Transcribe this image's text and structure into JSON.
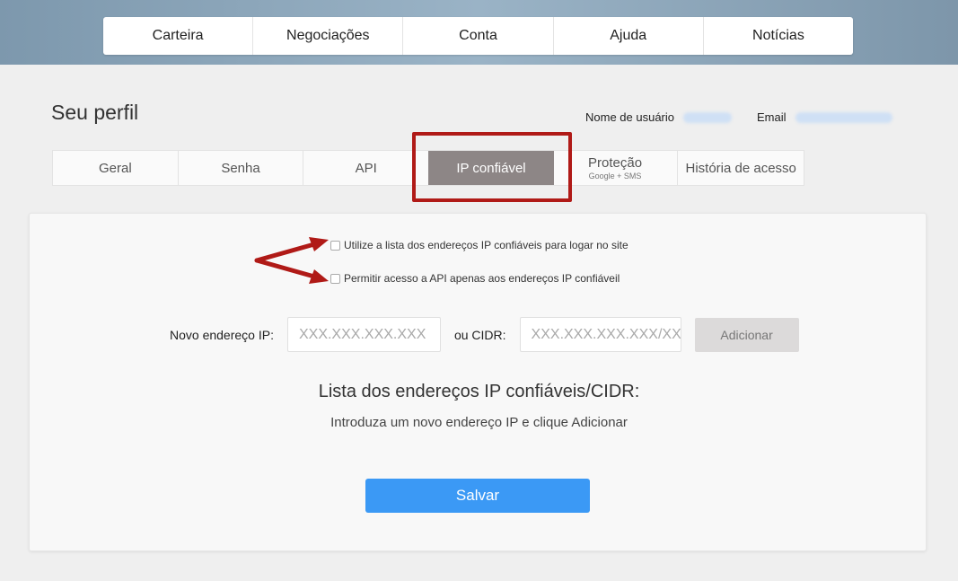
{
  "nav": {
    "items": [
      "Carteira",
      "Negociações",
      "Conta",
      "Ajuda",
      "Notícias"
    ]
  },
  "profile": {
    "title": "Seu perfil",
    "username_label": "Nome de usuário",
    "email_label": "Email"
  },
  "tabs": {
    "geral": "Geral",
    "senha": "Senha",
    "api": "API",
    "ip": "IP confiável",
    "protecao": "Proteção",
    "protecao_sub": "Google + SMS",
    "historia": "História de acesso"
  },
  "options": {
    "use_list": "Utilize a lista dos endereços IP confiáveis para logar no site",
    "api_only": "Permitir acesso a API apenas aos endereços IP confiáveil"
  },
  "form": {
    "ip_label": "Novo endereço IP:",
    "ip_placeholder": "XXX.XXX.XXX.XXX",
    "cidr_label": "ou CIDR:",
    "cidr_placeholder": "XXX.XXX.XXX.XXX/XX",
    "add_label": "Adicionar"
  },
  "list": {
    "title": "Lista dos endereços IP confiáveis/CIDR:",
    "hint": "Introduza um novo endereço IP e clique Adicionar"
  },
  "save_label": "Salvar",
  "colors": {
    "annotation": "#b01a17",
    "primary": "#3b99f5",
    "active_tab": "#8d8686"
  }
}
